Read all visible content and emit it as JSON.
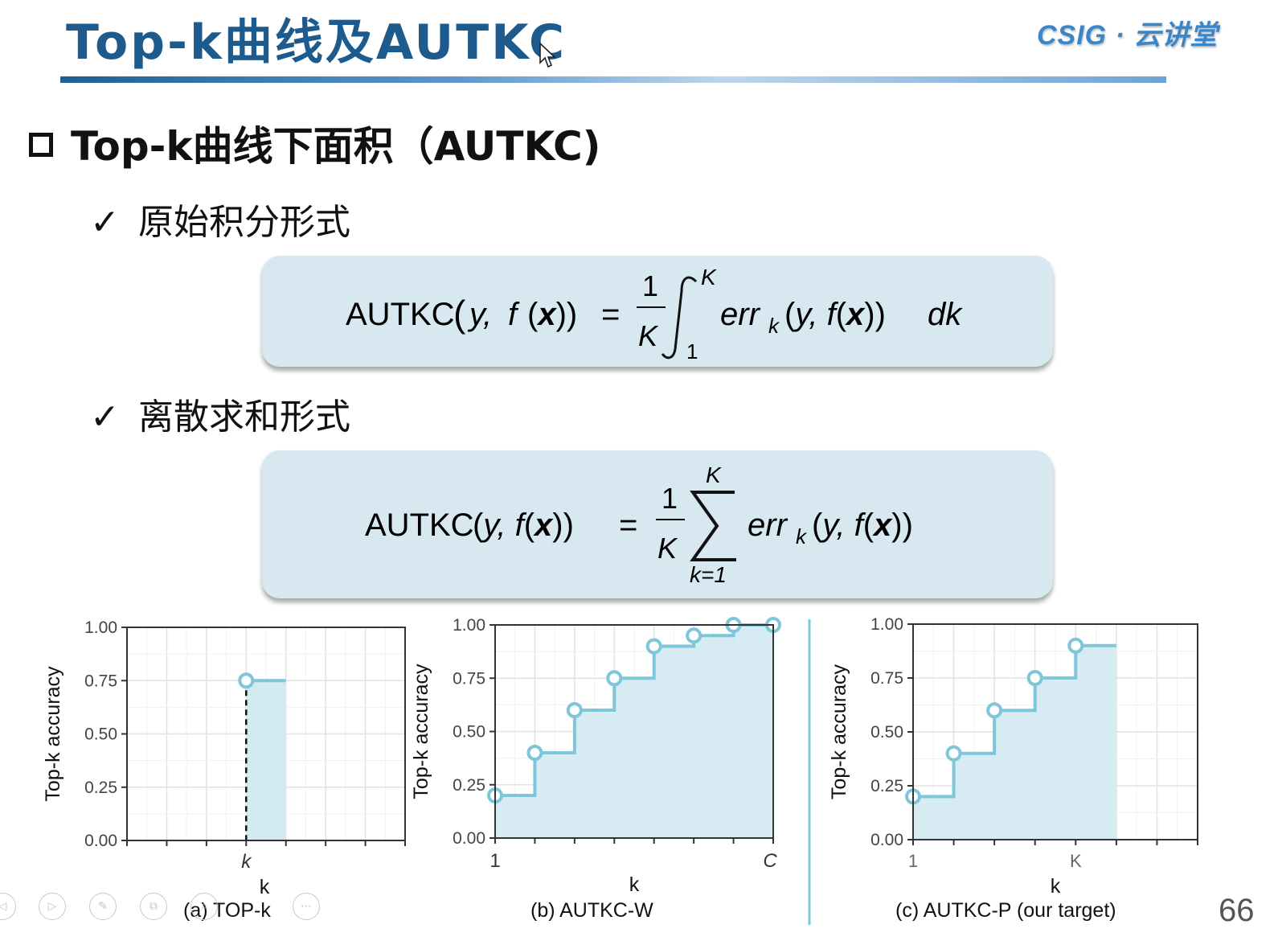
{
  "header": {
    "title": "Top-k曲线及AUTKC",
    "logo": "CSIG · 云讲堂"
  },
  "section": {
    "heading": "Top-k曲线下面积（AUTKC)"
  },
  "bullets": [
    {
      "check": "✓",
      "label": "原始积分形式"
    },
    {
      "check": "✓",
      "label": "离散求和形式"
    }
  ],
  "formulas": {
    "integral": {
      "lhs": "AUTKC",
      "num": "1",
      "den": "K",
      "upper": "K",
      "lower": "1",
      "err": "err",
      "sub": "k",
      "dk": "dk"
    },
    "sum": {
      "lhs": "AUTKC",
      "num": "1",
      "den": "K",
      "upper": "K",
      "lower": "k=1",
      "err": "err",
      "sub": "k"
    }
  },
  "chart_data": [
    {
      "type": "line",
      "caption": "(a) TOP-k",
      "xlabel": "k",
      "ylabel": "Top-k accuracy",
      "x_tick_labels": [
        "k"
      ],
      "ylim": [
        0,
        1
      ],
      "y_ticks": [
        "0.00",
        "0.25",
        "0.50",
        "0.75",
        "1.00"
      ],
      "x_steps": 7,
      "series": [
        {
          "x": [
            3
          ],
          "y": [
            0.75
          ]
        }
      ],
      "fill_range": [
        3,
        4
      ],
      "dashed_drop": true,
      "grid": true
    },
    {
      "type": "area",
      "caption": "(b) AUTKC-W",
      "xlabel": "k",
      "ylabel": "Top-k accuracy",
      "x_tick_labels": [
        "1",
        "C"
      ],
      "ylim": [
        0,
        1
      ],
      "y_ticks": [
        "0.00",
        "0.25",
        "0.50",
        "0.75",
        "1.00"
      ],
      "x_steps": 7,
      "series": [
        {
          "x": [
            0,
            1,
            2,
            3,
            4,
            5,
            6,
            7
          ],
          "y": [
            0.2,
            0.4,
            0.6,
            0.75,
            0.9,
            0.95,
            1.0,
            1.0
          ]
        }
      ],
      "grid": true
    },
    {
      "type": "area",
      "caption": "(c) AUTKC-P (our target)",
      "xlabel": "k",
      "ylabel": "Top-k accuracy",
      "x_tick_labels": [
        "1",
        "K"
      ],
      "ylim": [
        0,
        1
      ],
      "y_ticks": [
        "0.00",
        "0.25",
        "0.50",
        "0.75",
        "1.00"
      ],
      "x_steps": 7,
      "series": [
        {
          "x": [
            0,
            1,
            2,
            3,
            4
          ],
          "y": [
            0.2,
            0.4,
            0.6,
            0.75,
            0.9
          ]
        }
      ],
      "fill_range": [
        0,
        5
      ],
      "grid": true
    }
  ],
  "page_number": "66",
  "colors": {
    "title": "#1d5b8e",
    "accent_line": "#7ec6d9",
    "fill": "#d4eaf1",
    "box": "#d8e8f1"
  }
}
